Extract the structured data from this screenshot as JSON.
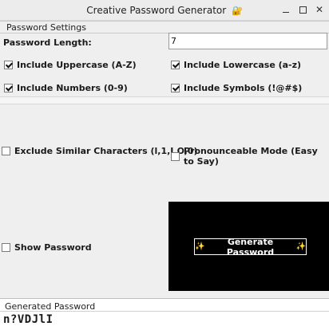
{
  "window": {
    "title": "Creative Password Generator",
    "title_icon": "🔐",
    "controls": [
      "minimize",
      "maximize",
      "close"
    ]
  },
  "settings": {
    "group_title": "Password Settings",
    "length_label": "Password Length:",
    "length_value": "7",
    "options": {
      "uppercase": {
        "label": "Include Uppercase (A-Z)",
        "checked": true
      },
      "lowercase": {
        "label": "Include Lowercase (a-z)",
        "checked": true
      },
      "numbers": {
        "label": "Include Numbers (0-9)",
        "checked": true
      },
      "symbols": {
        "label": "Include Symbols (!@#$)",
        "checked": true
      },
      "exclude_similar": {
        "label": "Exclude Similar Characters (l,1,I,O,0)",
        "checked": false
      },
      "pronounceable": {
        "label": "Pronounceable Mode (Easy to Say)",
        "checked": false
      },
      "show_password": {
        "label": "Show Password",
        "checked": false
      }
    }
  },
  "actions": {
    "generate_label": "Generate Password",
    "generate_icon": "✨"
  },
  "output": {
    "title": "Generated Password",
    "value": "n?VDJlI"
  },
  "colors": {
    "button_panel": "#000000",
    "button_border": "#ffffff",
    "window_bg": "#efefef",
    "title_icon": "#d7a425"
  }
}
